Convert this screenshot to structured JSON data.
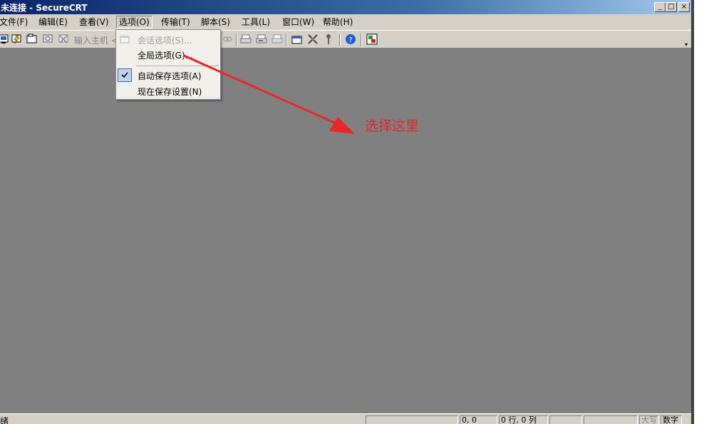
{
  "window": {
    "title": "未连接 - SecureCRT",
    "minimize_glyph": "_",
    "maximize_glyph": "□",
    "close_glyph": "×"
  },
  "menu": {
    "items": [
      {
        "label": "文件(F)"
      },
      {
        "label": "编辑(E)"
      },
      {
        "label": "查看(V)"
      },
      {
        "label": "选项(O)"
      },
      {
        "label": "传输(T)"
      },
      {
        "label": "脚本(S)"
      },
      {
        "label": "工具(L)"
      },
      {
        "label": "窗口(W)"
      },
      {
        "label": "帮助(H)"
      }
    ]
  },
  "toolbar": {
    "quick_connect_text": "输入主机 <",
    "icons": [
      "connect-icon",
      "quick-connect-icon",
      "connect-tab-icon",
      "reconnect-icon",
      "disconnect-icon",
      "find-icon",
      "print-icon",
      "print-selection-icon",
      "print-screen-icon",
      "session-options-icon",
      "global-options-icon",
      "keymap-icon",
      "help-icon",
      "sftp-icon"
    ]
  },
  "dropdown": {
    "items": [
      {
        "label": "会话选项(S)...",
        "enabled": false
      },
      {
        "label": "全局选项(G)...",
        "enabled": true
      },
      {
        "label": "自动保存选项(A)",
        "enabled": true,
        "checked": true
      },
      {
        "label": "现在保存设置(N)",
        "enabled": true
      }
    ]
  },
  "annotation": {
    "text": "选择这里",
    "color": "#e0282a"
  },
  "statusbar": {
    "text": "绪",
    "panes": [
      "",
      "0, 0",
      "0 行, 0 列",
      "",
      "",
      "大写",
      "数字"
    ]
  }
}
